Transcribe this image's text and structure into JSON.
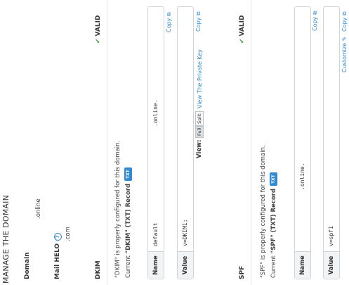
{
  "page": {
    "title": "MANAGE THE DOMAIN"
  },
  "domain": {
    "label": "Domain",
    "value": ".online"
  },
  "mail_helo": {
    "label": "Mail HELO",
    "value": ".com"
  },
  "dkim": {
    "label": "DKIM",
    "status": "VALID",
    "message": "\"DKIM\" is properly configured for this domain.",
    "current_prefix": "Current ",
    "current_name": "\"DKIM\"",
    "current_suffix": " (TXT) Record",
    "badge": "TXT",
    "rows": [
      {
        "key": "Name",
        "value": "default",
        "value_right": ".online.",
        "copy": "Copy"
      },
      {
        "key": "Value",
        "value": "v=DKIM1;",
        "copy": "Copy"
      }
    ],
    "view_label": "View:",
    "view_options": [
      "Full",
      "Split"
    ],
    "private_key_link": "View The Private Key"
  },
  "spf": {
    "label": "SPF",
    "status": "VALID",
    "message": "\"SPF\" is properly configured for this domain.",
    "current_prefix": "Current ",
    "current_name": "\"SPF\"",
    "current_suffix": " (TXT) Record",
    "badge": "TXT",
    "rows": [
      {
        "key": "Name",
        "value": ".online.",
        "copy": "Copy"
      },
      {
        "key": "Value",
        "value": "v=spf1",
        "copy": "Copy"
      }
    ],
    "customize_link": "Customize"
  }
}
